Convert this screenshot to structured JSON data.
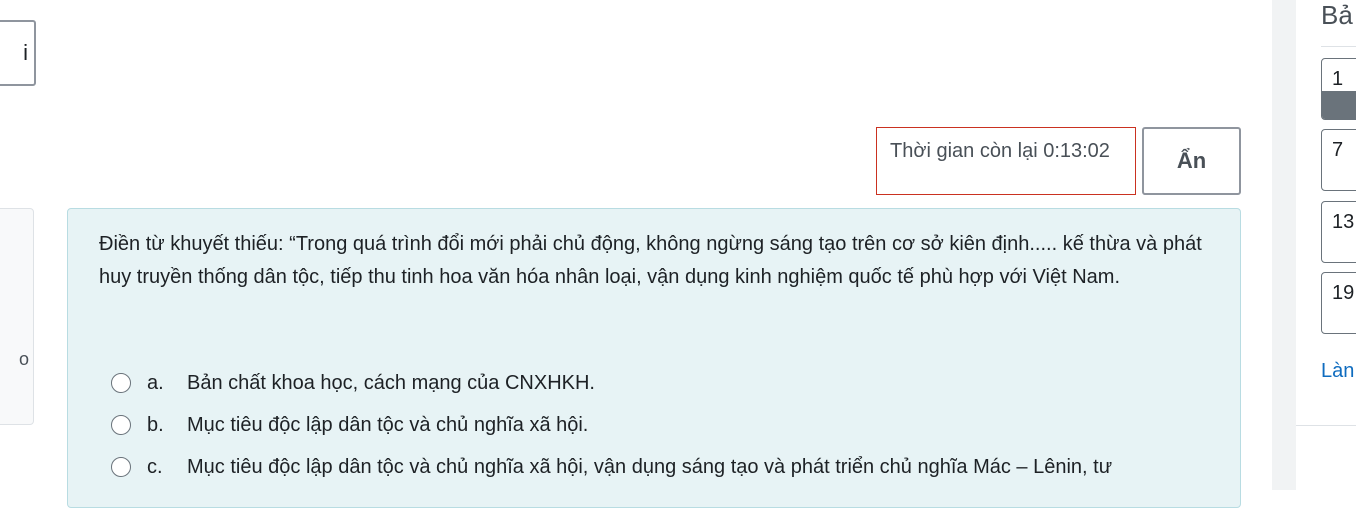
{
  "nav": {
    "prev_label": "i"
  },
  "timer": {
    "text": "Thời gian còn lại 0:13:02",
    "hide_label": "Ẩn"
  },
  "left_card": {
    "fragment": "o"
  },
  "question": {
    "text": "Điền từ khuyết thiếu: “Trong quá trình đổi mới phải chủ động, không ngừng sáng tạo trên cơ sở kiên định..... kế thừa và phát huy truyền thống dân tộc, tiếp thu tinh hoa văn hóa nhân loại, vận dụng kinh nghiệm quốc tế phù hợp với Việt Nam.",
    "answers": [
      {
        "letter": "a.",
        "text": "Bản chất khoa học, cách mạng của CNXHKH."
      },
      {
        "letter": "b.",
        "text": "Mục tiêu độc lập dân tộc và chủ nghĩa xã hội."
      },
      {
        "letter": "c.",
        "text": "Mục tiêu độc lập dân tộc và chủ nghĩa xã hội, vận dụng sáng tạo và phát triển chủ nghĩa Mác – Lênin, tư"
      }
    ]
  },
  "quiz_nav": {
    "title": "Bả",
    "buttons": [
      {
        "label": "1",
        "current": true
      },
      {
        "label": "7",
        "current": false
      },
      {
        "label": "13",
        "current": false
      },
      {
        "label": "19",
        "current": false
      }
    ],
    "link_label": "Làn"
  },
  "colors": {
    "question_bg": "#e7f3f5",
    "timer_border": "#ca3120",
    "link": "#0f6cbf",
    "current_flag": "#6a737b"
  }
}
